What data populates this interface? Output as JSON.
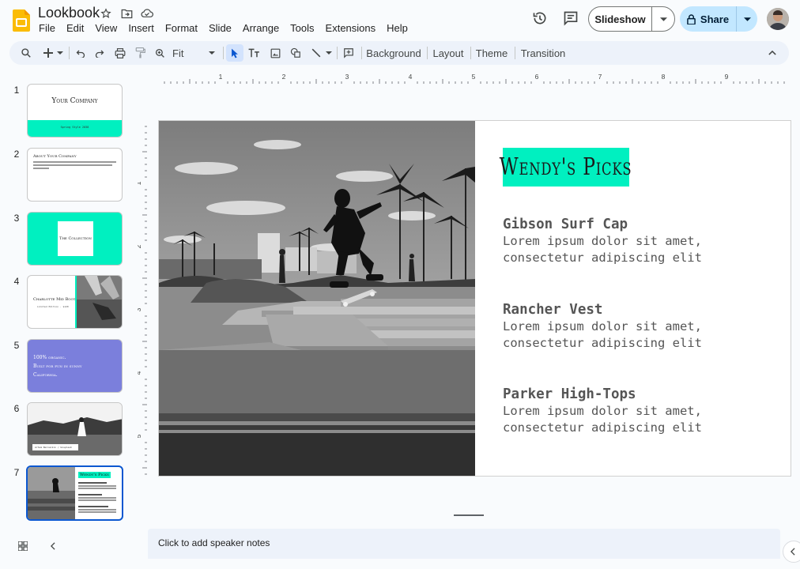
{
  "app": {
    "title": "Lookbook",
    "brand_color": "#fbbc04"
  },
  "menu": [
    "File",
    "Edit",
    "View",
    "Insert",
    "Format",
    "Slide",
    "Arrange",
    "Tools",
    "Extensions",
    "Help"
  ],
  "header": {
    "slideshow_label": "Slideshow",
    "share_label": "Share",
    "share_color": "#c2e7ff"
  },
  "toolbar": {
    "zoom_label": "Fit",
    "background_label": "Background",
    "layout_label": "Layout",
    "theme_label": "Theme",
    "transition_label": "Transition"
  },
  "ruler": {
    "h_labels": [
      "1",
      "2",
      "3",
      "4",
      "5",
      "6",
      "7",
      "8",
      "9"
    ],
    "v_labels": [
      "1",
      "2",
      "3",
      "4",
      "5"
    ]
  },
  "slides": [
    {
      "num": "1",
      "title": "Your Company",
      "subtitle": "Spring Style 2038"
    },
    {
      "num": "2",
      "title": "About Your Company"
    },
    {
      "num": "3",
      "title": "The Collection"
    },
    {
      "num": "4",
      "title": "Charlotte Mid Boot",
      "subtitle": "Limited Edition · $120"
    },
    {
      "num": "5",
      "lines": [
        "100% organic.",
        "Built for fun in sunny",
        "California."
      ]
    },
    {
      "num": "6",
      "caption": "Artem Beliaikin / Unsplash"
    },
    {
      "num": "7",
      "title": "Wendy's Picks"
    }
  ],
  "active_slide": 7,
  "current_slide": {
    "heading": "Wendy's Picks",
    "accent_color": "#00f0c0",
    "items": [
      {
        "name": "Gibson Surf Cap",
        "line1": "Lorem ipsum dolor sit amet,",
        "line2": "consectetur adipiscing elit"
      },
      {
        "name": "Rancher Vest",
        "line1": "Lorem ipsum dolor sit amet,",
        "line2": "consectetur adipiscing elit"
      },
      {
        "name": "Parker High-Tops",
        "line1": "Lorem ipsum dolor sit amet,",
        "line2": "consectetur adipiscing elit"
      }
    ]
  },
  "notes": {
    "placeholder": "Click to add speaker notes"
  }
}
